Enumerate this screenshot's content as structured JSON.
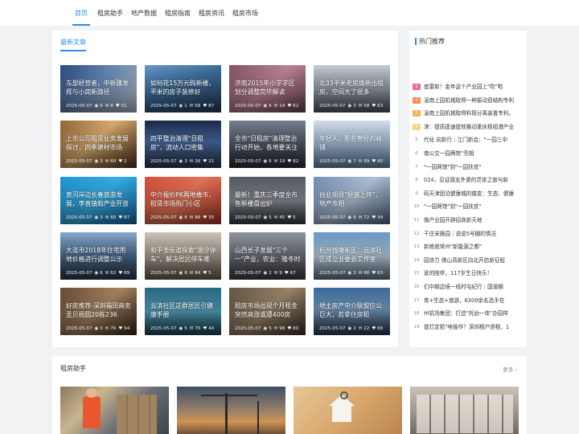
{
  "nav": {
    "items": [
      {
        "label": "首页",
        "active": true
      },
      {
        "label": "租房助手",
        "active": false
      },
      {
        "label": "地产数据",
        "active": false
      },
      {
        "label": "租房指南",
        "active": false
      },
      {
        "label": "租房资讯",
        "active": false
      },
      {
        "label": "租房市场",
        "active": false
      }
    ],
    "accent_color": "#2d8ce8"
  },
  "latest": {
    "title": "最新文章",
    "cards": [
      {
        "title": "东部经营者，中新疆发挥与小岗新路径",
        "date": "2025-05-07",
        "views": "6",
        "comments": "8",
        "likes": "51"
      },
      {
        "title": "如何花15万元购新楼，平米的房子装修好",
        "date": "2025-05-07",
        "views": "1",
        "comments": "58",
        "likes": "87"
      },
      {
        "title": "济南2015年小学学区划分调整完毕解读",
        "date": "2025-05-07",
        "views": "6",
        "comments": "14",
        "likes": "62"
      },
      {
        "title": "北33平米老房焕新出租房，空间大了很多",
        "date": "2025-05-07",
        "views": "3",
        "comments": "58",
        "likes": "63"
      },
      {
        "title": "上市公司租赁业务发展探讨，四季建材市场",
        "date": "2025-05-07",
        "views": "3",
        "comments": "60",
        "likes": "2"
      },
      {
        "title": "四平整治清理\"日租房\"，流动人口密集",
        "date": "2025-05-07",
        "views": "3",
        "comments": "26",
        "likes": "21"
      },
      {
        "title": "全市\"日租房\"清理整治行动开始，各地要关注",
        "date": "2025-05-07",
        "views": "6",
        "comments": "19",
        "likes": "82"
      },
      {
        "title": "年轻人，那些曾经的商铺",
        "date": "2025-05-07",
        "views": "7",
        "comments": "99",
        "likes": "40"
      },
      {
        "title": "黄河岸边长春旅游发展，李直镇和产业开放结合",
        "date": "2025-05-07",
        "views": "3",
        "comments": "60",
        "likes": "87"
      },
      {
        "title": "中介报价PK两地楼市，租赁市场热门小区",
        "date": "2025-05-07",
        "views": "8",
        "comments": "86",
        "likes": "35"
      },
      {
        "title": "最新！重庆三季度全市售新楼盘出炉",
        "date": "2025-05-07",
        "views": "5",
        "comments": "45",
        "likes": "5"
      },
      {
        "title": "创业项目\"轻装上阵\"，地产市相",
        "date": "2025-05-07",
        "views": "6",
        "comments": "72",
        "likes": "34"
      },
      {
        "title": "大连市2018年住宅用地价格进行调整公示",
        "date": "2025-05-07",
        "views": "6",
        "comments": "62",
        "likes": "89"
      },
      {
        "title": "和平里街道探索\"潮汐停车\"，解决居民停车难",
        "date": "2025-05-07",
        "views": "8",
        "comments": "84",
        "likes": "5"
      },
      {
        "title": "山西长子发展\"三个一\"产业，农业：隆冬时节，种养助增收",
        "date": "2025-05-07",
        "views": "2",
        "comments": "9",
        "likes": "67"
      },
      {
        "title": "杭州钱塘新区：云滨社区成立业委会工作室",
        "date": "2025-05-07",
        "views": "3",
        "comments": "66",
        "likes": "63"
      },
      {
        "title": "好房推荐-深圳福田商务圣贝丽圆20栋236",
        "date": "2025-05-07",
        "views": "3",
        "comments": "76",
        "likes": "94"
      },
      {
        "title": "云滨社区这群居民引健康手册",
        "date": "2025-05-07",
        "views": "5",
        "comments": "70",
        "likes": "44"
      },
      {
        "title": "租房市场出现个月租金突然高涨或遭400房",
        "date": "2025-05-07",
        "views": "5",
        "comments": "98",
        "likes": "80"
      },
      {
        "title": "地主房产中介联盟应公巨大，若拿住房租",
        "date": "2025-05-07",
        "views": "2",
        "comments": "22",
        "likes": "66"
      }
    ]
  },
  "hot": {
    "title": "热门推荐",
    "items": [
      {
        "num": "1",
        "text": "度要新！金年这个产业园上\"吹\"啦"
      },
      {
        "num": "2",
        "text": "凌南上园机械取得一种振动盘结构专利"
      },
      {
        "num": "3",
        "text": "凌南上园机械取得料筒分离装置专利。"
      },
      {
        "num": "4",
        "text": "津：提质提速提效推动重庆枢纽港产业"
      },
      {
        "num": "5",
        "text": "代化 向新行｜江门新会：\"一园三中"
      },
      {
        "num": "6",
        "text": "南公交一园两馆\"亮相"
      },
      {
        "num": "7",
        "text": "\"一园两馆\"到\"一园扶贫\""
      },
      {
        "num": "8",
        "text": "024，见证朋友外婆的灵体之旅与新"
      },
      {
        "num": "9",
        "text": "码天津团泊健康城的蝶变：生态、健康"
      },
      {
        "num": "10",
        "text": "\"一园两馆\"到\"一园扶贫\""
      },
      {
        "num": "11",
        "text": "微产业园开辟招商新天地"
      },
      {
        "num": "12",
        "text": "干庄采摘园｜说说5号棚的情况"
      },
      {
        "num": "13",
        "text": "新练就常州\"新能源之都\""
      },
      {
        "num": "14",
        "text": "园协力 佛山高新区向北开启新征程"
      },
      {
        "num": "15",
        "text": "爱的陪伴，117岁生日快乐！"
      },
      {
        "num": "16",
        "text": "们中朝边境一线村屯纪行｜国道朝"
      },
      {
        "num": "17",
        "text": "育+生态+旅游，6300余名选手在"
      },
      {
        "num": "18",
        "text": "州机场集团：打造\"托幼一体\"办园样"
      },
      {
        "num": "19",
        "text": "提灯定损\"啥操作？深圳租户退租，1"
      }
    ]
  },
  "helper": {
    "title": "租房助手",
    "more": "更多",
    "more_icon": "chevron-right-icon"
  }
}
